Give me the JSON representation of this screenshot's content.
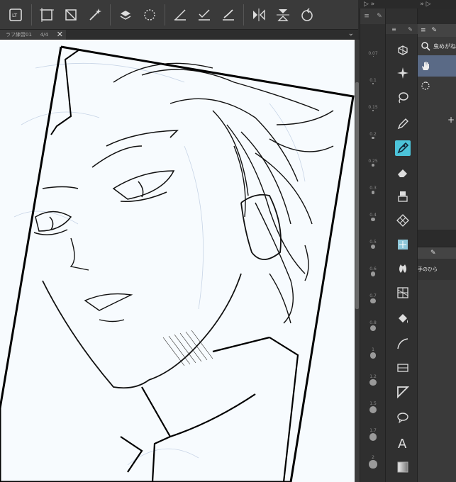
{
  "canvas_tab": {
    "title": "ラフ練習01",
    "zoom": "4/4",
    "close_glyph": "✕"
  },
  "tab_menu_glyph": "⌄",
  "right_header": {
    "left_glyphs": "▷ »",
    "right_glyphs": "» ▷"
  },
  "brush_sizes": [
    "0.07",
    "0.1",
    "0.15",
    "0.2",
    "0.25",
    "0.3",
    "0.4",
    "0.5",
    "0.6",
    "0.7",
    "0.8",
    "1",
    "1.2",
    "1.5",
    "1.7",
    "2",
    "2.5"
  ],
  "subtool": {
    "tab_label": "虫めがね",
    "items": [
      {
        "label": "虫めがね",
        "icon": "magnifier-icon"
      },
      {
        "label": "",
        "icon": "hand-icon"
      },
      {
        "label": "",
        "icon": "rotate-icon"
      }
    ],
    "add_glyph": "+"
  },
  "lower_panel": {
    "item_label": "手のひら"
  },
  "tools": [
    "zoom-tool-icon",
    "move-icon",
    "select-auto-icon",
    "lasso-icon",
    "pen-icon",
    "pencil-icon",
    "eraser-icon",
    "blend-icon",
    "decoration-icon",
    "airbrush-icon",
    "figure-icon",
    "frame-icon",
    "fill-icon",
    "gradient-icon",
    "curve-icon",
    "ruler-icon",
    "text-icon",
    "balloon-icon",
    "color-icon"
  ],
  "colors": {
    "ui_dark": "#2b2b2b",
    "panel": "#3a3a3a",
    "accent": "#4cc3d9",
    "selected_row": "#5a6a86",
    "canvas_bg": "#f7fbfe"
  }
}
